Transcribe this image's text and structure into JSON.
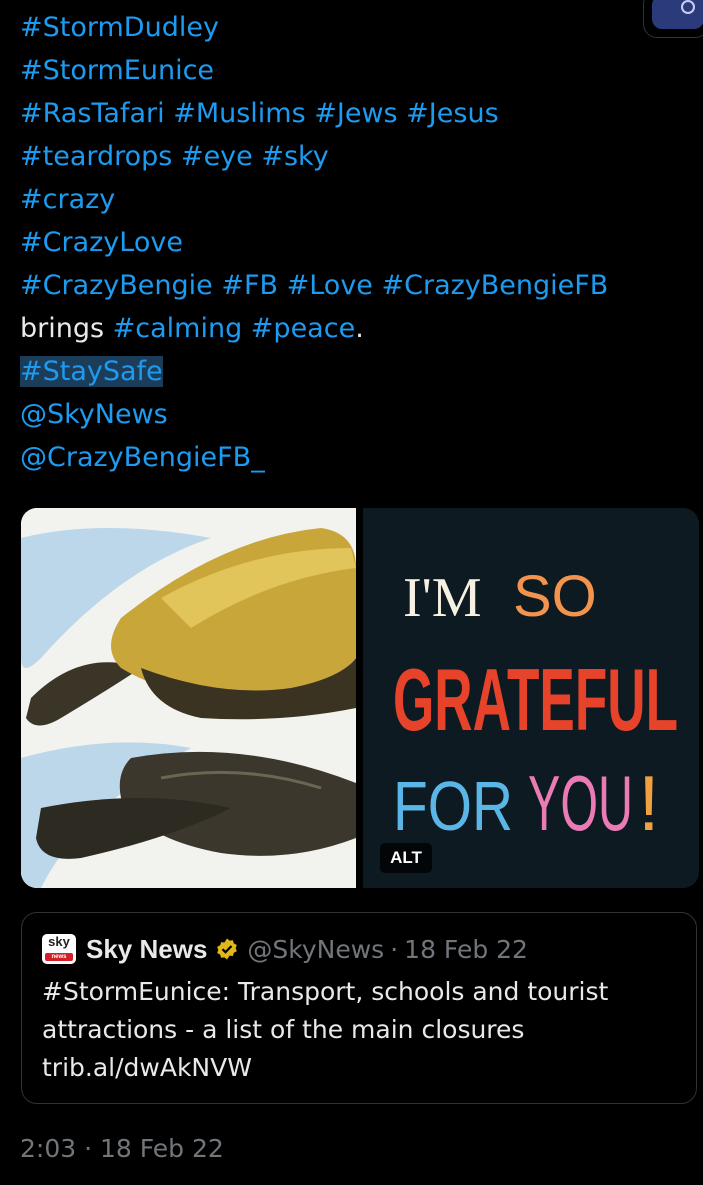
{
  "tweet": {
    "lines": [
      [
        {
          "t": "#StormDudley",
          "k": "tag"
        }
      ],
      [
        {
          "t": "#StormEunice",
          "k": "tag"
        }
      ],
      [
        {
          "t": "#RasTafari #Muslims #Jews #Jesus",
          "k": "tag"
        }
      ],
      [
        {
          "t": "#teardrops #eye #sky",
          "k": "tag"
        }
      ],
      [
        {
          "t": "#crazy",
          "k": "tag"
        }
      ],
      [
        {
          "t": "#CrazyLove",
          "k": "tag"
        }
      ],
      [
        {
          "t": "#CrazyBengie #FB #Love #CrazyBengieFB",
          "k": "tag"
        }
      ],
      [
        {
          "t": "brings ",
          "k": "plain"
        },
        {
          "t": "#calming #peace",
          "k": "tag"
        },
        {
          "t": ".",
          "k": "plain"
        }
      ],
      [
        {
          "t": "#StaySafe",
          "k": "tag selected"
        }
      ],
      [
        {
          "t": "@SkyNews",
          "k": "tag"
        }
      ],
      [
        {
          "t": "@CrazyBengieFB_",
          "k": "tag"
        }
      ]
    ],
    "media": {
      "left_image": "bananas-photo",
      "right_image": {
        "line1_a": "I'M",
        "line1_b": "SO",
        "line2": "GRATEFUL",
        "line3_a": "FOR",
        "line3_b": "YOU",
        "line3_c": "!"
      },
      "alt_label": "ALT"
    },
    "timestamp": "2:03 · 18 Feb 22"
  },
  "quote": {
    "logo_text": "sky",
    "logo_sub": "news",
    "name": "Sky News",
    "handle": "@SkyNews",
    "separator": "·",
    "date": "18 Feb 22",
    "body": "#StormEunice: Transport, schools and tourist attractions - a list of the main closures trib.al/dwAkNVW"
  },
  "colors": {
    "background": "#000000",
    "link": "#1d9bf0",
    "text": "#e7e9ea",
    "muted": "#71767b",
    "verified_badge": "#e2b719",
    "text_selection": "#1c3d5a"
  }
}
